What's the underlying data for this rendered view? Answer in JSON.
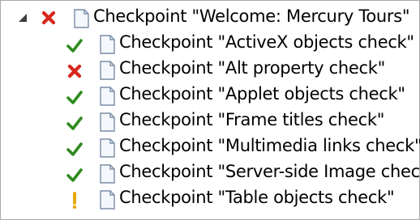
{
  "tree": {
    "root": {
      "label": "Checkpoint \"Welcome: Mercury Tours\"",
      "status": "fail",
      "expanded": true
    },
    "children": [
      {
        "label": "Checkpoint \"ActiveX objects check\"",
        "status": "pass"
      },
      {
        "label": "Checkpoint \"Alt property check\"",
        "status": "fail"
      },
      {
        "label": "Checkpoint \"Applet objects check\"",
        "status": "pass"
      },
      {
        "label": "Checkpoint \"Frame titles check\"",
        "status": "pass"
      },
      {
        "label": "Checkpoint \"Multimedia links check\"",
        "status": "pass"
      },
      {
        "label": "Checkpoint \"Server-side Image check\"",
        "status": "pass"
      },
      {
        "label": "Checkpoint \"Table objects check\"",
        "status": "warning"
      }
    ]
  },
  "colors": {
    "pass": "#2e8b1e",
    "fail": "#d8261c",
    "warning": "#e8a400",
    "border": "#a9a9a9",
    "doc_outline": "#7a8da8",
    "doc_fill": "#f4f7fb",
    "expander": "#3d3d3d"
  },
  "icons": {
    "expander": "expanded-triangle-icon",
    "pass": "check-icon",
    "fail": "x-icon",
    "warning": "exclamation-icon",
    "document": "document-icon"
  }
}
